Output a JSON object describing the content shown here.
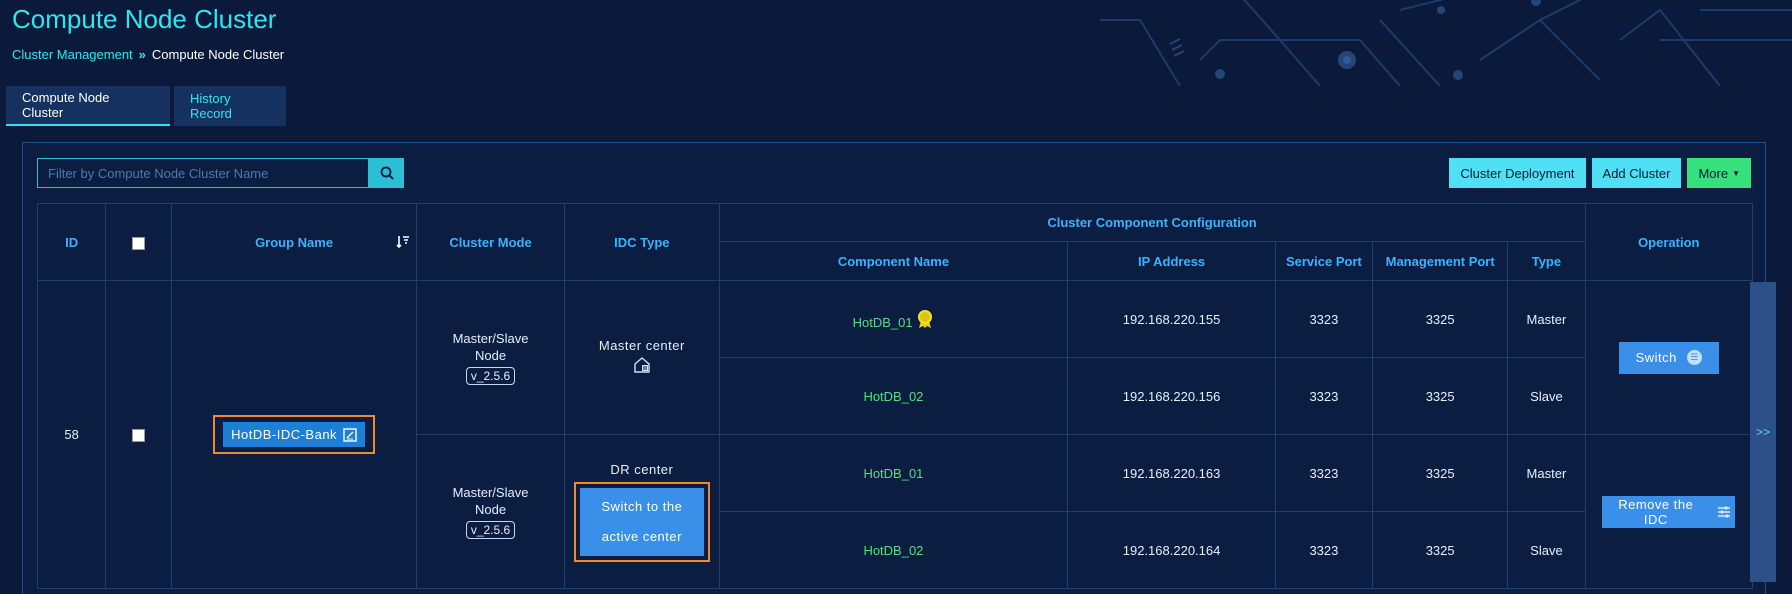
{
  "page": {
    "title": "Compute Node Cluster"
  },
  "breadcrumb": {
    "link": "Cluster Management",
    "separator": "»",
    "current": "Compute Node Cluster"
  },
  "tabs": [
    {
      "label": "Compute Node Cluster"
    },
    {
      "label": "History Record"
    }
  ],
  "search": {
    "placeholder": "Filter by Compute Node Cluster Name",
    "icon": "search-icon"
  },
  "actions": {
    "deploy": "Cluster Deployment",
    "add": "Add Cluster",
    "more": "More"
  },
  "table": {
    "headers": {
      "id": "ID",
      "group_name": "Group Name",
      "cluster_mode": "Cluster Mode",
      "idc_type": "IDC Type",
      "component_config": "Cluster Component Configuration",
      "operation": "Operation",
      "component_name": "Component Name",
      "ip": "IP Address",
      "service_port": "Service Port",
      "management_port": "Management Port",
      "type": "Type"
    },
    "row": {
      "id": "58",
      "group_name": "HotDB-IDC-Bank",
      "idc": [
        {
          "mode_line1": "Master/Slave",
          "mode_line2": "Node",
          "version": "v_2.5.6",
          "label": "Master center",
          "components": [
            {
              "name": "HotDB_01",
              "ip": "192.168.220.155",
              "service_port": "3323",
              "management_port": "3325",
              "type": "Master",
              "vip": true
            },
            {
              "name": "HotDB_02",
              "ip": "192.168.220.156",
              "service_port": "3323",
              "management_port": "3325",
              "type": "Slave"
            }
          ],
          "operation": "Switch"
        },
        {
          "mode_line1": "Master/Slave",
          "mode_line2": "Node",
          "version": "v_2.5.6",
          "label": "DR center",
          "switch_line1": "Switch to the",
          "switch_line2": "active center",
          "components": [
            {
              "name": "HotDB_01",
              "ip": "192.168.220.163",
              "service_port": "3323",
              "management_port": "3325",
              "type": "Master"
            },
            {
              "name": "HotDB_02",
              "ip": "192.168.220.164",
              "service_port": "3323",
              "management_port": "3325",
              "type": "Slave"
            }
          ],
          "operation": "Remove the IDC"
        }
      ]
    }
  },
  "side_expand": ">>",
  "colors": {
    "accent": "#2ee6f0",
    "header": "#39b3ff",
    "component": "#4fe07a",
    "highlight": "#f08a2e",
    "button": "#3a8fe8"
  }
}
